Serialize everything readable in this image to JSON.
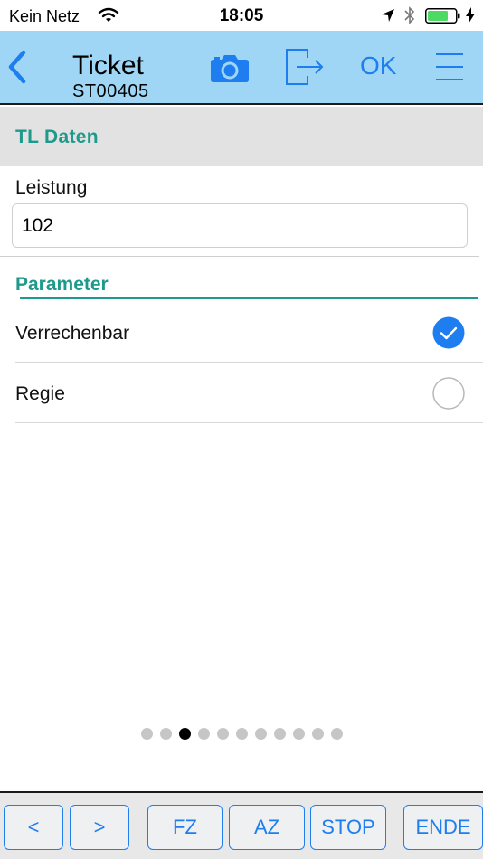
{
  "status_bar": {
    "carrier": "Kein Netz",
    "time": "18:05",
    "icons": [
      "wifi-icon",
      "location-arrow-icon",
      "bluetooth-icon",
      "battery-icon",
      "charging-bolt-icon"
    ],
    "battery_color": "#4cd964"
  },
  "nav": {
    "back_icon": "chevron-left-icon",
    "title": "Ticket",
    "subtitle": "ST00405",
    "camera_icon": "camera-icon",
    "export_icon": "export-arrow-icon",
    "ok_label": "OK",
    "menu_icon": "hamburger-menu-icon",
    "background_color": "#9fd6f5",
    "accent_color": "#1e7ef0"
  },
  "section": {
    "title": "TL Daten",
    "color": "#1e9a8c"
  },
  "form": {
    "leistung_label": "Leistung",
    "leistung_value": "102"
  },
  "parameter": {
    "title": "Parameter",
    "items": [
      {
        "label": "Verrechenbar",
        "checked": true
      },
      {
        "label": "Regie",
        "checked": false
      }
    ]
  },
  "pager": {
    "total": 11,
    "active_index": 2
  },
  "toolbar": {
    "prev_label": "<",
    "next_label": ">",
    "fz_label": "FZ",
    "az_label": "AZ",
    "stop_label": "STOP",
    "ende_label": "ENDE"
  }
}
